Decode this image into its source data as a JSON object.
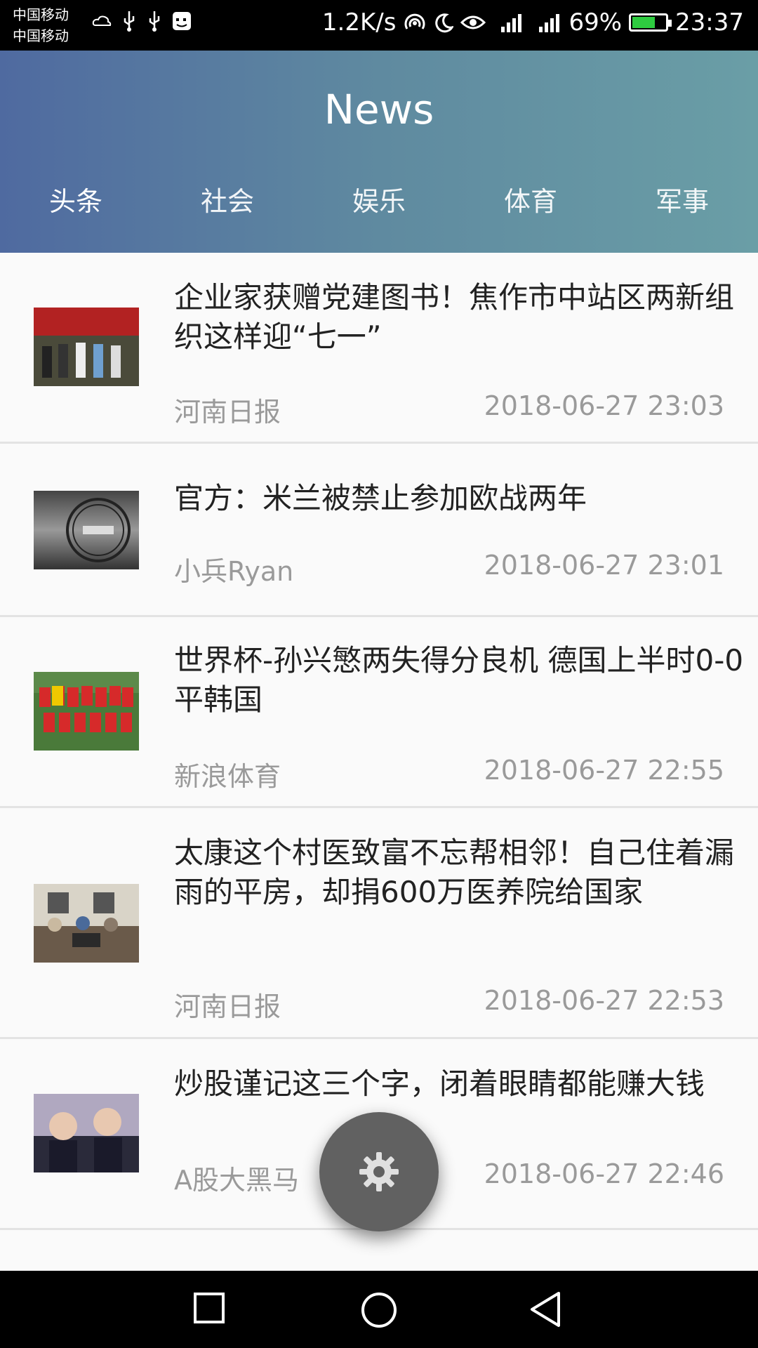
{
  "status_bar": {
    "carrier_1": "中国移动",
    "carrier_2": "中国移动",
    "speed": "1.2K/s",
    "battery": "69%",
    "time": "23:37"
  },
  "header": {
    "title": "News",
    "tabs": [
      {
        "label": "头条"
      },
      {
        "label": "社会"
      },
      {
        "label": "娱乐"
      },
      {
        "label": "体育"
      },
      {
        "label": "军事"
      }
    ]
  },
  "news": [
    {
      "title": "企业家获赠党建图书！焦作市中站区两新组织这样迎“七一”",
      "source": "河南日报",
      "time": "2018-06-27 23:03"
    },
    {
      "title": "官方：米兰被禁止参加欧战两年",
      "source": "小兵Ryan",
      "time": "2018-06-27 23:01"
    },
    {
      "title": "世界杯-孙兴慜两失得分良机 德国上半时0-0平韩国",
      "source": "新浪体育",
      "time": "2018-06-27 22:55"
    },
    {
      "title": "太康这个村医致富不忘帮相邻！自己住着漏雨的平房，却捐600万医养院给国家",
      "source": "河南日报",
      "time": "2018-06-27 22:53"
    },
    {
      "title": "炒股谨记这三个字，闭着眼睛都能赚大钱",
      "source": "A股大黑马",
      "time": "2018-06-27 22:46"
    }
  ],
  "colors": {
    "tab_indicator": "#ff4d8a",
    "fab": "#616161"
  },
  "icons": {
    "fab": "gear-icon",
    "nav_recent": "square-icon",
    "nav_home": "circle-icon",
    "nav_back": "triangle-back-icon"
  }
}
